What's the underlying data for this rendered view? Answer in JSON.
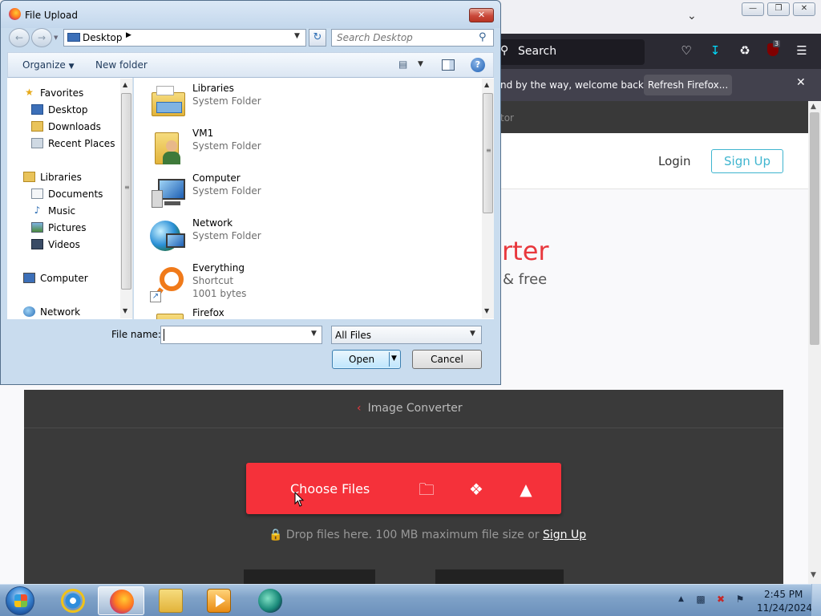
{
  "firefox": {
    "search_placeholder": "Search",
    "notification_message": "nd by the way, welcome back!",
    "notification_button": "Refresh Firefox...",
    "extensions_badge": "3",
    "nav_crumb_fragment": "tor",
    "site": {
      "login": "Login",
      "signup": "Sign Up",
      "hero_title_fragment": "rter",
      "hero_subtitle_fragment": "& free",
      "converter_crumb": "Image Converter",
      "choose_files": "Choose Files",
      "drop_note": "Drop files here. 100 MB maximum file size or",
      "drop_note_link": "Sign Up"
    }
  },
  "dialog": {
    "title": "File Upload",
    "address": "Desktop",
    "search_placeholder": "Search Desktop",
    "organize": "Organize",
    "new_folder": "New folder",
    "nav": {
      "favorites": "Favorites",
      "desktop": "Desktop",
      "downloads": "Downloads",
      "recent_places": "Recent Places",
      "libraries": "Libraries",
      "documents": "Documents",
      "music": "Music",
      "pictures": "Pictures",
      "videos": "Videos",
      "computer": "Computer",
      "network": "Network"
    },
    "files": [
      {
        "name": "Libraries",
        "type": "System Folder",
        "icon": "libraries-folder-icon"
      },
      {
        "name": "VM1",
        "type": "System Folder",
        "icon": "user-folder-icon"
      },
      {
        "name": "Computer",
        "type": "System Folder",
        "icon": "computer-icon"
      },
      {
        "name": "Network",
        "type": "System Folder",
        "icon": "network-icon"
      },
      {
        "name": "Everything",
        "type": "Shortcut",
        "size": "1001 bytes",
        "icon": "everything-search-icon"
      },
      {
        "name": "Firefox",
        "icon": "firefox-folder-icon"
      }
    ],
    "file_name_label": "File name:",
    "file_name_value": "",
    "file_type": "All Files",
    "open": "Open",
    "cancel": "Cancel"
  },
  "taskbar": {
    "time": "2:45 PM",
    "date": "11/24/2024"
  },
  "colors": {
    "brand_red": "#f5313a",
    "link_teal": "#3fb5cf",
    "ff_toolbar": "#2b2a33"
  }
}
